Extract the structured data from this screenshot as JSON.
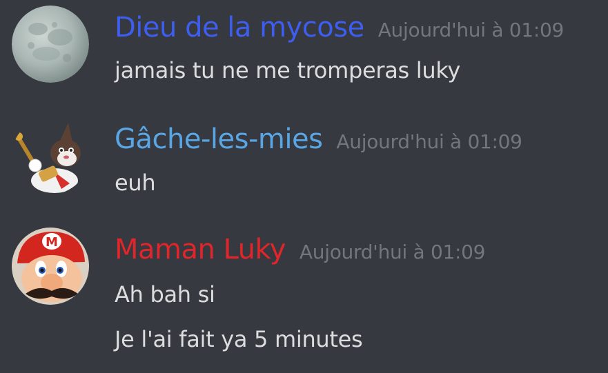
{
  "messages": [
    {
      "author": "Dieu de la mycose",
      "author_color": "#3e5ef0",
      "timestamp": "Aujourd'hui à 01:09",
      "avatar_icon": "moon-avatar",
      "lines": [
        "jamais tu ne me tromperas luky"
      ]
    },
    {
      "author": "Gâche-les-mies",
      "author_color": "#5aa6e4",
      "timestamp": "Aujourd'hui à 01:09",
      "avatar_icon": "cartoon-rabbit-avatar",
      "lines": [
        "euh"
      ]
    },
    {
      "author": "Maman Luky",
      "author_color": "#e0262a",
      "timestamp": "Aujourd'hui à 01:09",
      "avatar_icon": "mario-avatar",
      "lines": [
        "Ah bah si",
        "Je l'ai fait ya 5 minutes"
      ]
    }
  ]
}
